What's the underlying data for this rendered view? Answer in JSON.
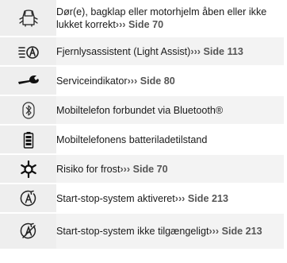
{
  "rows": [
    {
      "icon": "car-door-open-icon",
      "text": "Dør(e), bagklap eller motorhjelm åben eller ikke lukket korrekt",
      "arrow": "›››",
      "ref": "Side 70"
    },
    {
      "icon": "light-assist-icon",
      "text": "Fjernlysassistent (Light Assist)",
      "arrow": "›››",
      "ref": "Side 113"
    },
    {
      "icon": "wrench-icon",
      "text": "Serviceindikator",
      "arrow": "›››",
      "ref": "Side 80"
    },
    {
      "icon": "bluetooth-icon",
      "text": "Mobiltelefon forbundet via Bluetooth®",
      "arrow": "",
      "ref": ""
    },
    {
      "icon": "battery-icon",
      "text": "Mobiltelefonens batteriladetilstand",
      "arrow": "",
      "ref": ""
    },
    {
      "icon": "snowflake-icon",
      "text": "Risiko for frost",
      "arrow": "›››",
      "ref": "Side 70"
    },
    {
      "icon": "start-stop-active-icon",
      "text": "Start-stop-system aktiveret",
      "arrow": "›››",
      "ref": "Side 213"
    },
    {
      "icon": "start-stop-unavailable-icon",
      "text": "Start-stop-system ikke tilgængeligt",
      "arrow": "›››",
      "ref": "Side 213"
    }
  ]
}
